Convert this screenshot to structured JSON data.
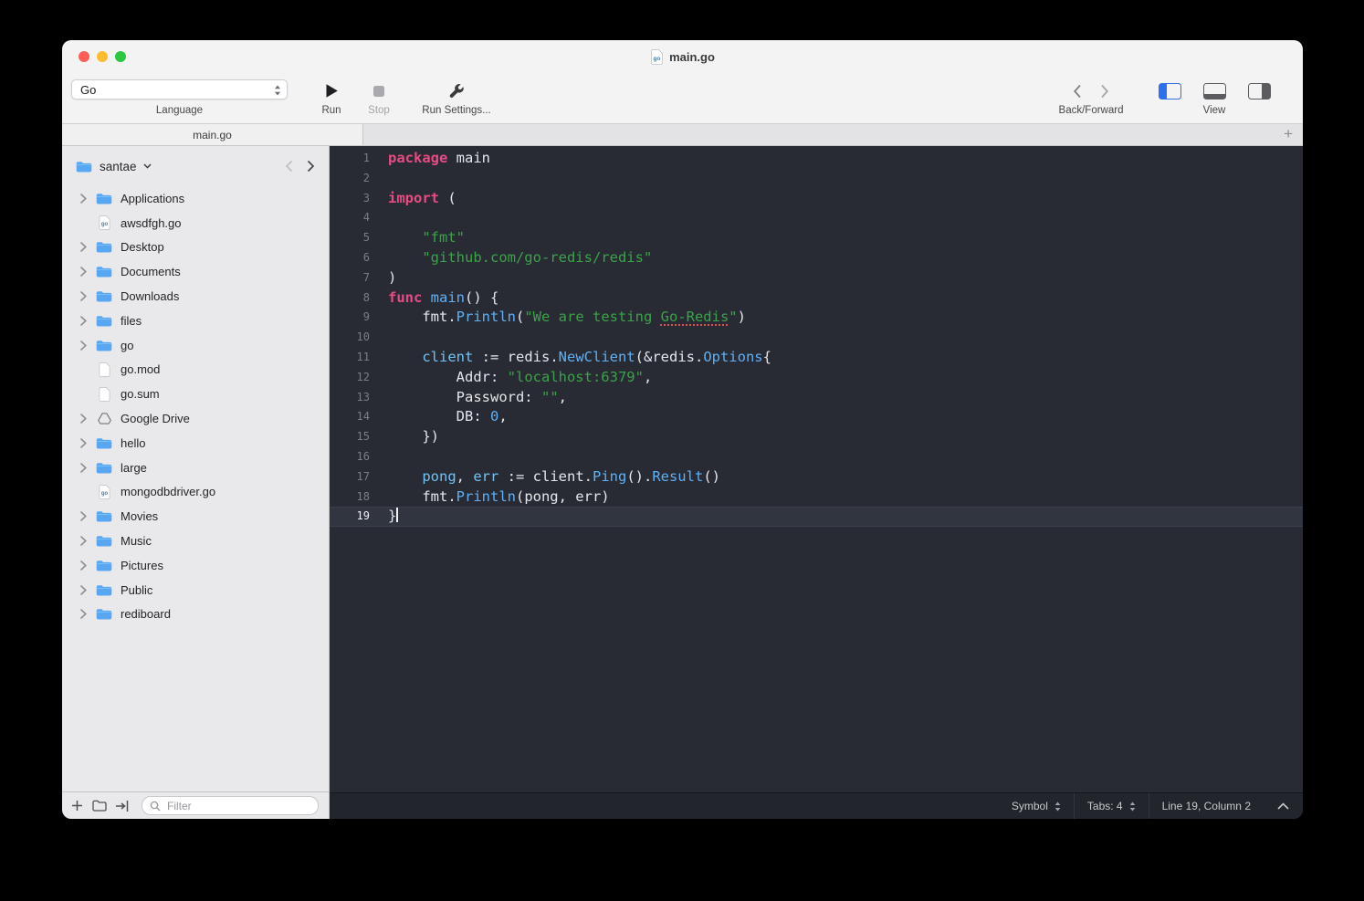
{
  "window": {
    "title": "main.go"
  },
  "toolbar": {
    "language": {
      "value": "Go",
      "label": "Language"
    },
    "run_label": "Run",
    "stop_label": "Stop",
    "run_settings_label": "Run Settings...",
    "back_forward_label": "Back/Forward",
    "view_label": "View"
  },
  "tabs": {
    "active": "main.go",
    "add_label": "+"
  },
  "sidebar": {
    "root": "santae",
    "filter_placeholder": "Filter",
    "items": [
      {
        "name": "Applications",
        "type": "folder",
        "chevron": true
      },
      {
        "name": "awsdfgh.go",
        "type": "gofile",
        "chevron": false
      },
      {
        "name": "Desktop",
        "type": "folder",
        "chevron": true
      },
      {
        "name": "Documents",
        "type": "folder",
        "chevron": true
      },
      {
        "name": "Downloads",
        "type": "folder",
        "chevron": true
      },
      {
        "name": "files",
        "type": "folder",
        "chevron": true
      },
      {
        "name": "go",
        "type": "folder",
        "chevron": true
      },
      {
        "name": "go.mod",
        "type": "file",
        "chevron": false
      },
      {
        "name": "go.sum",
        "type": "file",
        "chevron": false
      },
      {
        "name": "Google Drive",
        "type": "gdrive",
        "chevron": true
      },
      {
        "name": "hello",
        "type": "folder",
        "chevron": true
      },
      {
        "name": "large",
        "type": "folder",
        "chevron": true
      },
      {
        "name": "mongodbdriver.go",
        "type": "gofile",
        "chevron": false
      },
      {
        "name": "Movies",
        "type": "folder",
        "chevron": true
      },
      {
        "name": "Music",
        "type": "folder",
        "chevron": true
      },
      {
        "name": "Pictures",
        "type": "folder",
        "chevron": true
      },
      {
        "name": "Public",
        "type": "folder",
        "chevron": true
      },
      {
        "name": "rediboard",
        "type": "folder",
        "chevron": true
      }
    ]
  },
  "editor": {
    "language": "Go",
    "current_line": 19,
    "lines": [
      {
        "n": 1,
        "tokens": [
          {
            "t": "package",
            "c": "kw"
          },
          {
            "t": " main",
            "c": "def"
          }
        ]
      },
      {
        "n": 2,
        "tokens": []
      },
      {
        "n": 3,
        "tokens": [
          {
            "t": "import",
            "c": "kw"
          },
          {
            "t": " (",
            "c": "def"
          }
        ]
      },
      {
        "n": 4,
        "tokens": []
      },
      {
        "n": 5,
        "tokens": [
          {
            "t": "    ",
            "c": "def"
          },
          {
            "t": "\"fmt\"",
            "c": "str"
          }
        ]
      },
      {
        "n": 6,
        "tokens": [
          {
            "t": "    ",
            "c": "def"
          },
          {
            "t": "\"github.com/go-redis/redis\"",
            "c": "str"
          }
        ]
      },
      {
        "n": 7,
        "tokens": [
          {
            "t": ")",
            "c": "def"
          }
        ]
      },
      {
        "n": 8,
        "tokens": [
          {
            "t": "func",
            "c": "kw"
          },
          {
            "t": " ",
            "c": "def"
          },
          {
            "t": "main",
            "c": "fn"
          },
          {
            "t": "() {",
            "c": "def"
          }
        ]
      },
      {
        "n": 9,
        "tokens": [
          {
            "t": "    fmt.",
            "c": "def"
          },
          {
            "t": "Println",
            "c": "fn"
          },
          {
            "t": "(",
            "c": "def"
          },
          {
            "t": "\"We are testing ",
            "c": "str"
          },
          {
            "t": "Go-Redis",
            "c": "strmis"
          },
          {
            "t": "\"",
            "c": "str"
          },
          {
            "t": ")",
            "c": "def"
          }
        ]
      },
      {
        "n": 10,
        "tokens": []
      },
      {
        "n": 11,
        "tokens": [
          {
            "t": "    ",
            "c": "def"
          },
          {
            "t": "client",
            "c": "var"
          },
          {
            "t": " := redis.",
            "c": "def"
          },
          {
            "t": "NewClient",
            "c": "fn"
          },
          {
            "t": "(&redis.",
            "c": "def"
          },
          {
            "t": "Options",
            "c": "fn"
          },
          {
            "t": "{",
            "c": "def"
          }
        ]
      },
      {
        "n": 12,
        "tokens": [
          {
            "t": "        Addr: ",
            "c": "def"
          },
          {
            "t": "\"localhost:6379\"",
            "c": "str"
          },
          {
            "t": ",",
            "c": "def"
          }
        ]
      },
      {
        "n": 13,
        "tokens": [
          {
            "t": "        Password: ",
            "c": "def"
          },
          {
            "t": "\"\"",
            "c": "str"
          },
          {
            "t": ",",
            "c": "def"
          }
        ]
      },
      {
        "n": 14,
        "tokens": [
          {
            "t": "        DB: ",
            "c": "def"
          },
          {
            "t": "0",
            "c": "num"
          },
          {
            "t": ",",
            "c": "def"
          }
        ]
      },
      {
        "n": 15,
        "tokens": [
          {
            "t": "    })",
            "c": "def"
          }
        ]
      },
      {
        "n": 16,
        "tokens": []
      },
      {
        "n": 17,
        "tokens": [
          {
            "t": "    ",
            "c": "def"
          },
          {
            "t": "pong",
            "c": "var"
          },
          {
            "t": ", ",
            "c": "def"
          },
          {
            "t": "err",
            "c": "var"
          },
          {
            "t": " := client.",
            "c": "def"
          },
          {
            "t": "Ping",
            "c": "fn"
          },
          {
            "t": "().",
            "c": "def"
          },
          {
            "t": "Result",
            "c": "fn"
          },
          {
            "t": "()",
            "c": "def"
          }
        ]
      },
      {
        "n": 18,
        "tokens": [
          {
            "t": "    fmt.",
            "c": "def"
          },
          {
            "t": "Println",
            "c": "fn"
          },
          {
            "t": "(pong, err)",
            "c": "def"
          }
        ]
      },
      {
        "n": 19,
        "tokens": [
          {
            "t": "}",
            "c": "def"
          }
        ],
        "caret": true
      }
    ]
  },
  "statusbar": {
    "symbol_label": "Symbol",
    "tabs_label": "Tabs: 4",
    "position_label": "Line 19, Column 2"
  },
  "colors": {
    "keyword": "#e64c84",
    "string": "#3ca24a",
    "function": "#5fb0f5",
    "variable": "#72c3f6",
    "editor_bg": "#282b33",
    "accent_blue": "#2f6fed"
  }
}
